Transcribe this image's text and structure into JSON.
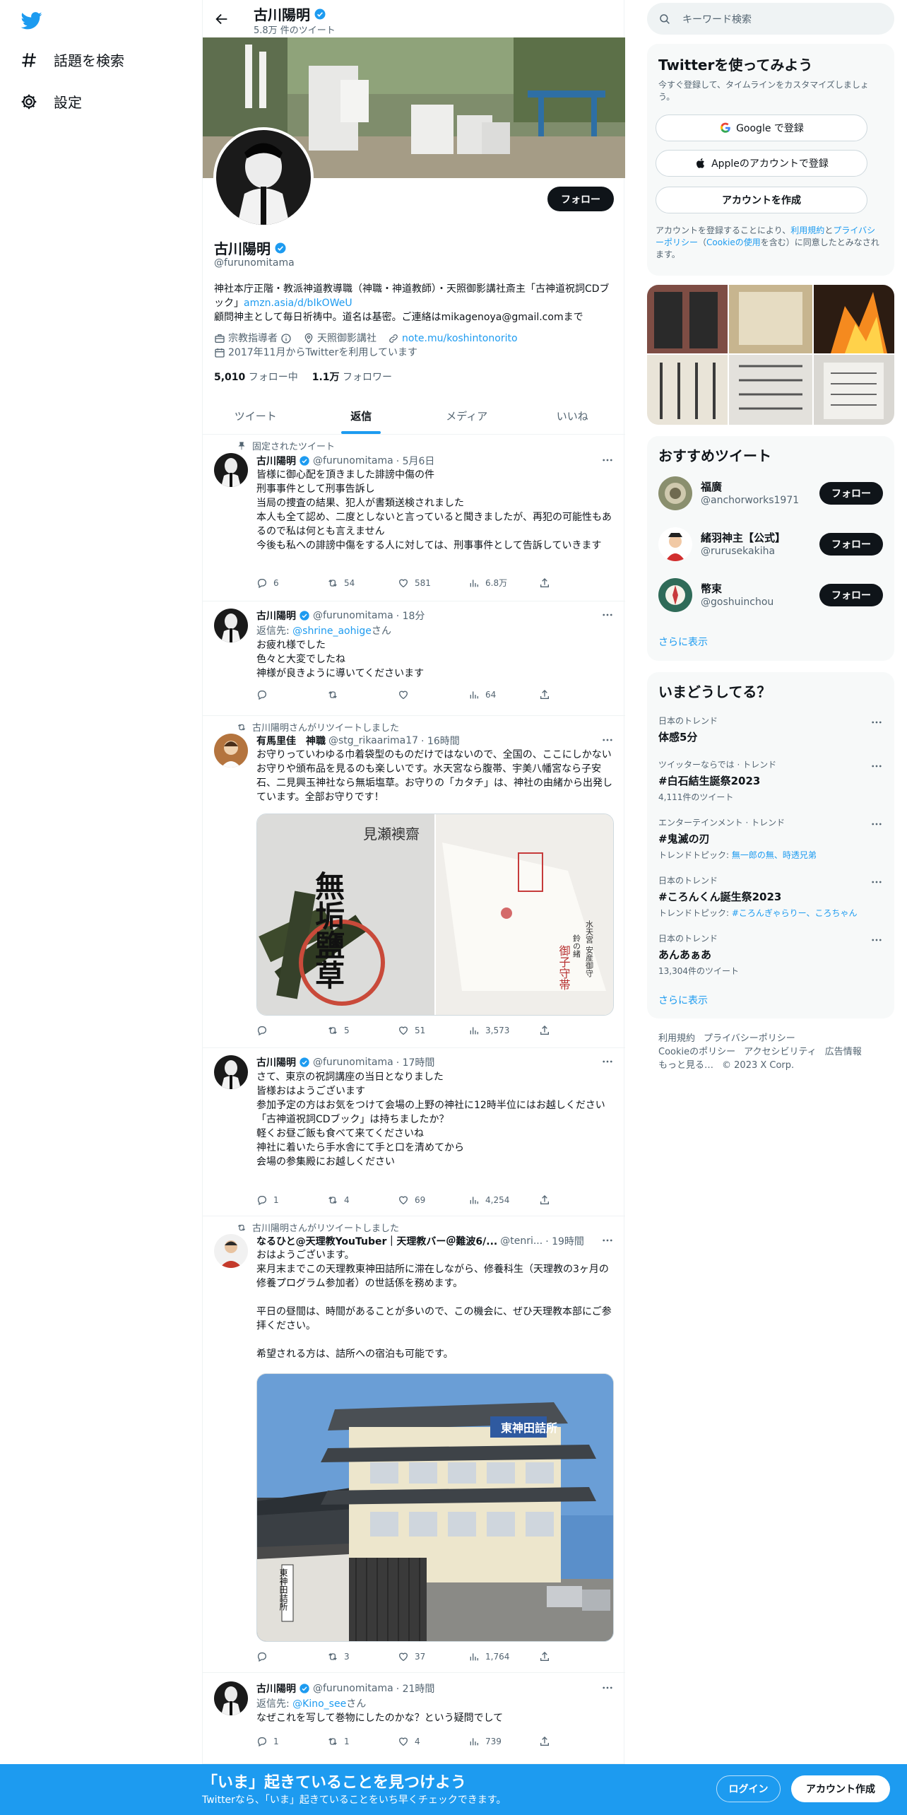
{
  "nav": {
    "explore": "話題を検索",
    "settings": "設定"
  },
  "header": {
    "name": "古川陽明",
    "tweet_count": "5.8万 件のツイート"
  },
  "profile": {
    "follow": "フォロー",
    "name": "古川陽明",
    "handle": "@furunomitama",
    "bio_1": "神社本庁正階・教派神道教導職（神職・神道教師）・天照御影講社斎主「古神道祝詞CDブック」",
    "bio_link": "amzn.asia/d/bIkOWeU",
    "bio_2": "顧問神主として毎日祈祷中。道名は基密。ご連絡はmikagenoya@gmail.comまで",
    "category": "宗教指導者",
    "location": "天照御影講社",
    "url": "note.mu/koshintonorito",
    "joined": "2017年11月からTwitterを利用しています",
    "following_count": "5,010",
    "following_label": "フォロー中",
    "followers_count": "1.1万",
    "followers_label": "フォロワー"
  },
  "tabs": [
    "ツイート",
    "返信",
    "メディア",
    "いいね"
  ],
  "tweets": [
    {
      "context": "固定されたツイート",
      "name": "古川陽明",
      "handle": "@furunomitama",
      "time": "· 5月6日",
      "text": "皆様に御心配を頂きました誹謗中傷の件\n刑事事件として刑事告訴し\n当局の捜査の結果、犯人が書類送検されました\n本人も全て認め、二度としないと言っていると聞きましたが、再犯の可能性もあるので私は何とも言えません\n今後も私への誹謗中傷をする人に対しては、刑事事件として告訴していきます",
      "replies": "6",
      "retweets": "54",
      "likes": "581",
      "views": "6.8万"
    },
    {
      "name": "古川陽明",
      "handle": "@furunomitama",
      "time": "· 18分",
      "reply_prefix": "返信先: ",
      "reply_to": "@shrine_aohige",
      "reply_suffix": "さん",
      "text": "お疲れ様でした\n色々と大変でしたね\n神様が良きように導いてくださいます",
      "replies": "",
      "retweets": "",
      "likes": "",
      "views": "64"
    },
    {
      "context": "古川陽明さんがリツイートしました",
      "name": "有馬里佳　神職",
      "handle": "@stg_rikaarima17",
      "time": "· 16時間",
      "text": "お守りっていわゆる巾着袋型のものだけではないので、全国の、ここにしかないお守りや頒布品を見るのも楽しいです。水天宮なら腹帯、宇美八幡宮なら子安石、二見興玉神社なら無垢塩草。お守りの「カタチ」は、神社の由緒から出発しています。全部お守りです！",
      "replies": "",
      "retweets": "5",
      "likes": "51",
      "views": "3,573"
    },
    {
      "name": "古川陽明",
      "handle": "@furunomitama",
      "time": "· 17時間",
      "text": "さて、東京の祝詞講座の当日となりました\n皆様おはようございます\n参加予定の方はお気をつけて会場の上野の神社に12時半位にはお越しください\n「古神道祝詞CDブック」は持ちましたか？\n軽くお昼ご飯も食べて来てくださいね\n神社に着いたら手水舎にて手と口を清めてから\n会場の参集殿にお越しください",
      "replies": "1",
      "retweets": "4",
      "likes": "69",
      "views": "4,254"
    },
    {
      "context": "古川陽明さんがリツイートしました",
      "name": "なるひと@天理教YouTuber｜天理教バー＠難波6/...",
      "handle": "@tenri...",
      "time": "· 19時間",
      "text": "おはようございます。\n来月末までこの天理教東神田詰所に滞在しながら、修養科生（天理教の3ヶ月の修養プログラム参加者）の世話係を務めます。\n\n平日の昼間は、時間があることが多いので、この機会に、ぜひ天理教本部にご参拝ください。\n\n希望される方は、詰所への宿泊も可能です。",
      "replies": "",
      "retweets": "3",
      "likes": "37",
      "views": "1,764"
    },
    {
      "name": "古川陽明",
      "handle": "@furunomitama",
      "time": "· 21時間",
      "reply_prefix": "返信先: ",
      "reply_to": "@Kino_see",
      "reply_suffix": "さん",
      "text": "なぜこれを写して巻物にしたのかな？という疑問でして",
      "replies": "1",
      "retweets": "1",
      "likes": "4",
      "views": "739"
    }
  ],
  "media": {
    "stamp_top": "見瀬襖齋",
    "stamp_main": "無垢鹽草",
    "box_label": "水天宮 安産御守",
    "box_sub": "鈴の緒",
    "box_title": "御子守帯",
    "building_sign": "東神田詰所",
    "gate_sign": "東神田詰所"
  },
  "right": {
    "search_placeholder": "キーワード検索",
    "signup_title": "Twitterを使ってみよう",
    "signup_sub": "今すぐ登録して、タイムラインをカスタマイズしましょう。",
    "google": "Google で登録",
    "apple": "Appleのアカウントで登録",
    "create": "アカウントを作成",
    "terms_1": "アカウントを登録することにより、",
    "terms_link1": "利用規約",
    "terms_2": "と",
    "terms_link2": "プライバシーポリシー",
    "terms_3": "（",
    "terms_link3": "Cookieの使用",
    "terms_4": "を含む）に同意したとみなされます。",
    "rec_title": "おすすめツイート",
    "recs": [
      {
        "name": "福廣",
        "handle": "@anchorworks1971",
        "button": "フォロー"
      },
      {
        "name": "緒羽神主【公式】",
        "handle": "@rurusekakiha",
        "button": "フォロー"
      },
      {
        "name": "幣束",
        "handle": "@goshuinchou",
        "button": "フォロー"
      }
    ],
    "show_more": "さらに表示",
    "trends_title": "いまどうしてる？",
    "trends": [
      {
        "context": "日本のトレンド",
        "name": "体感5分",
        "meta": ""
      },
      {
        "context": "ツイッターならでは · トレンド",
        "name": "#白石結生誕祭2023",
        "meta": "4,111件のツイート"
      },
      {
        "context": "エンターテインメント · トレンド",
        "name": "#鬼滅の刃",
        "meta_prefix": "トレンドトピック: ",
        "meta_link": "無一郎の無、時透兄弟"
      },
      {
        "context": "日本のトレンド",
        "name": "#ころんくん誕生祭2023",
        "meta_prefix": "トレンドトピック: ",
        "meta_link": "#ころんぎゃらりー、ころちゃん"
      },
      {
        "context": "日本のトレンド",
        "name": "あんあぁあ",
        "meta": "13,304件のツイート"
      }
    ],
    "show_more2": "さらに表示",
    "footer": [
      "利用規約",
      "プライバシーポリシー",
      "Cookieのポリシー",
      "アクセシビリティ",
      "広告情報",
      "もっと見る…",
      "© 2023 X Corp."
    ]
  },
  "bottom": {
    "title": "「いま」起きていることを見つけよう",
    "sub": "Twitterなら、「いま」起きていることをいち早くチェックできます。",
    "login": "ログイン",
    "signup": "アカウント作成"
  },
  "colors": {
    "accent": "#1d9bf0",
    "text": "#0f1419",
    "muted": "#536471",
    "bg_card": "#f7f9f9"
  }
}
